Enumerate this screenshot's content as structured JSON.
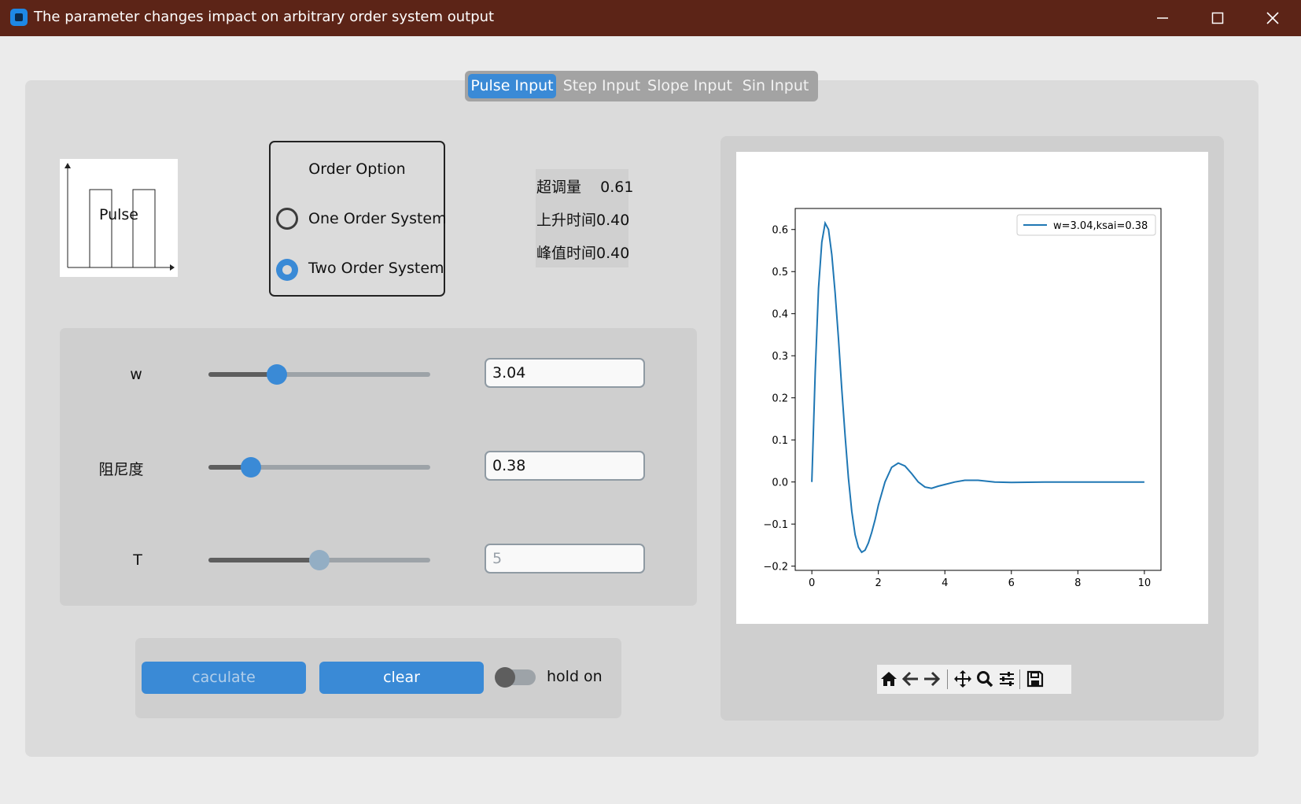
{
  "window": {
    "title": "The parameter changes impact on arbitrary order system output",
    "icon": "app-icon",
    "controls": [
      "minimize-icon",
      "maximize-icon",
      "close-icon"
    ]
  },
  "tabs": [
    {
      "label": "Pulse Input",
      "active": true
    },
    {
      "label": "Step Input",
      "active": false
    },
    {
      "label": "Slope Input",
      "active": false
    },
    {
      "label": "Sin Input",
      "active": false
    }
  ],
  "input_preview": {
    "label": "Pulse"
  },
  "order_option": {
    "title": "Order Option",
    "options": [
      {
        "label": "One Order System",
        "selected": false
      },
      {
        "label": "Two Order System",
        "selected": true
      }
    ]
  },
  "stats": {
    "overshoot": "超调量    0.61",
    "rise_time": "上升时间0.40",
    "peak_time": "峰值时间0.40"
  },
  "params": [
    {
      "label": "w",
      "value": "3.04",
      "slider_fraction": 0.31,
      "enabled": true
    },
    {
      "label": "阻尼度",
      "value": "0.38",
      "slider_fraction": 0.19,
      "enabled": true
    },
    {
      "label": "T",
      "value": "5",
      "slider_fraction": 0.5,
      "enabled": false
    }
  ],
  "buttons": {
    "calculate": "caculate",
    "clear": "clear"
  },
  "hold_on": {
    "label": "hold on",
    "on": false
  },
  "toolbar": {
    "icons": [
      "home-icon",
      "back-arrow-icon",
      "forward-arrow-icon",
      "pan-icon",
      "zoom-icon",
      "configure-subplots-icon",
      "save-icon"
    ]
  },
  "colors": {
    "accent": "#3a8ad6",
    "title_bar": "#5c2417",
    "line": "#1f77b4"
  },
  "chart_data": {
    "type": "line",
    "series": [
      {
        "name": "w=3.04,ksai=0.38",
        "x": [
          0,
          0.1,
          0.2,
          0.3,
          0.4,
          0.5,
          0.6,
          0.7,
          0.8,
          0.9,
          1.0,
          1.1,
          1.2,
          1.3,
          1.4,
          1.5,
          1.6,
          1.7,
          1.8,
          1.9,
          2.0,
          2.2,
          2.4,
          2.6,
          2.8,
          3.0,
          3.2,
          3.4,
          3.6,
          3.8,
          4.0,
          4.3,
          4.6,
          5.0,
          5.5,
          6.0,
          7.0,
          8.0,
          9.0,
          10.0
        ],
        "y": [
          0.0,
          0.26,
          0.46,
          0.57,
          0.615,
          0.6,
          0.54,
          0.45,
          0.34,
          0.22,
          0.11,
          0.01,
          -0.07,
          -0.125,
          -0.155,
          -0.167,
          -0.162,
          -0.145,
          -0.12,
          -0.09,
          -0.055,
          0.0,
          0.035,
          0.045,
          0.038,
          0.02,
          0.0,
          -0.012,
          -0.015,
          -0.01,
          -0.006,
          0.0,
          0.004,
          0.004,
          0.0,
          -0.001,
          0.0,
          0.0,
          0.0,
          0.0
        ]
      }
    ],
    "xlim": [
      -0.5,
      10.5
    ],
    "ylim": [
      -0.21,
      0.65
    ],
    "xticks": [
      0,
      2,
      4,
      6,
      8,
      10
    ],
    "yticks": [
      0.6,
      0.5,
      0.4,
      0.3,
      0.2,
      0.1,
      0.0,
      -0.1,
      -0.2
    ],
    "ytick_labels": [
      "0.6",
      "0.5",
      "0.4",
      "0.3",
      "0.2",
      "0.1",
      "0.0",
      "−0.1",
      "−0.2"
    ],
    "legend_position": "top-right",
    "grid": false
  }
}
